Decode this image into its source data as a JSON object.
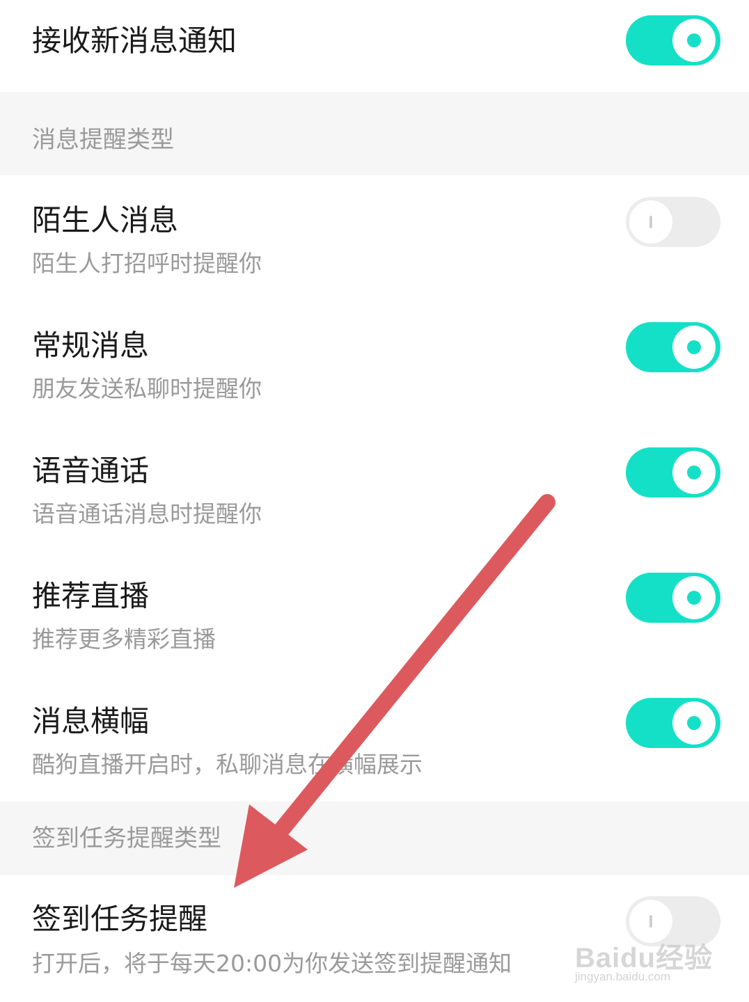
{
  "colors": {
    "toggle_on": "#14e0c7",
    "toggle_off": "#ececec",
    "section_bg": "#f6f6f6",
    "arrow": "#dc5a5e"
  },
  "top_setting": {
    "title": "接收新消息通知",
    "enabled": true
  },
  "section_message_types": {
    "label": "消息提醒类型",
    "items": [
      {
        "title": "陌生人消息",
        "subtitle": "陌生人打招呼时提醒你",
        "enabled": false
      },
      {
        "title": "常规消息",
        "subtitle": "朋友发送私聊时提醒你",
        "enabled": true
      },
      {
        "title": "语音通话",
        "subtitle": "语音通话消息时提醒你",
        "enabled": true
      },
      {
        "title": "推荐直播",
        "subtitle": "推荐更多精彩直播",
        "enabled": true
      },
      {
        "title": "消息横幅",
        "subtitle": "酷狗直播开启时，私聊消息在横幅展示",
        "enabled": true
      }
    ]
  },
  "section_checkin": {
    "label": "签到任务提醒类型",
    "items": [
      {
        "title": "签到任务提醒",
        "subtitle": "打开后，将于每天20:00为你发送签到提醒通知",
        "enabled": false
      }
    ]
  },
  "watermark": {
    "brand": "Baidu经验",
    "url": "jingyan.baidu.com"
  },
  "annotation": {
    "icon": "red-arrow-icon"
  }
}
